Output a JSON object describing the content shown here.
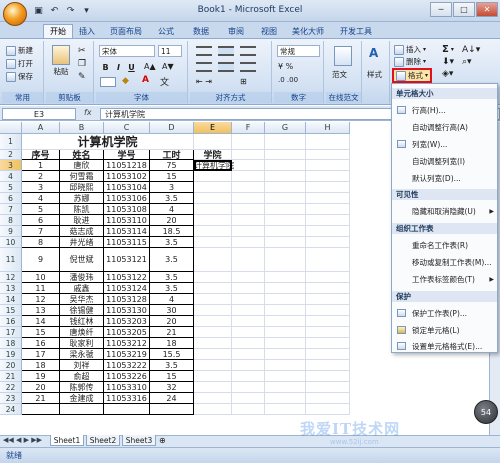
{
  "window": {
    "title": "Book1 - Microsoft Excel"
  },
  "qat": [
    "save",
    "undo",
    "redo",
    "customize"
  ],
  "tabs": [
    "开始",
    "插入",
    "页面布局",
    "公式",
    "数据",
    "审阅",
    "视图",
    "美化大师",
    "开发工具"
  ],
  "ribbon": {
    "common": {
      "new": "新建",
      "open": "打开",
      "save": "保存",
      "label": "常用"
    },
    "clipboard": {
      "paste": "粘贴",
      "label": "剪贴板"
    },
    "font": {
      "name": "宋体",
      "size": "11",
      "bold": "B",
      "italic": "I",
      "underline": "U",
      "label": "字体"
    },
    "align": {
      "label": "对齐方式"
    },
    "number": {
      "format": "常规",
      "label": "数字"
    },
    "style": {
      "label": "样式",
      "fanwen": "范文",
      "online": "在线范文"
    },
    "cells": {
      "insert": "插入",
      "delete": "删除",
      "format": "格式"
    },
    "editing": {
      "sigma": "Σ"
    }
  },
  "formula": {
    "namebox": "E3",
    "fx": "fx",
    "content": "计算机学院"
  },
  "columns": [
    "A",
    "B",
    "C",
    "D",
    "E",
    "F",
    "G",
    "H"
  ],
  "sheet": {
    "title": "计算机学院",
    "header": [
      "序号",
      "姓名",
      "学号",
      "工时",
      "学院"
    ],
    "e3": "计算机学院",
    "rows": [
      [
        "1",
        "唐欣",
        "11051218",
        "75"
      ],
      [
        "2",
        "何雪霜",
        "11053102",
        "15"
      ],
      [
        "3",
        "邱晓熙",
        "11053104",
        "3"
      ],
      [
        "4",
        "苏娜",
        "11053106",
        "3.5"
      ],
      [
        "5",
        "陈凯",
        "11053108",
        "4"
      ],
      [
        "6",
        "耿进",
        "11053110",
        "20"
      ],
      [
        "7",
        "菇志成",
        "11053114",
        "18.5"
      ],
      [
        "8",
        "井光绪",
        "11053115",
        "3.5"
      ],
      [
        "9",
        "倪世斌",
        "11053121",
        "3.5"
      ],
      [
        "10",
        "潘俊玮",
        "11053122",
        "3.5"
      ],
      [
        "11",
        "戚鑫",
        "11053124",
        "3.5"
      ],
      [
        "12",
        "吴华杰",
        "11053128",
        "4"
      ],
      [
        "13",
        "徐锡健",
        "11053130",
        "30"
      ],
      [
        "14",
        "钱红林",
        "11053203",
        "20"
      ],
      [
        "15",
        "唐焕纤",
        "11053205",
        "21"
      ],
      [
        "16",
        "耿家利",
        "11053212",
        "18"
      ],
      [
        "17",
        "梁永虢",
        "11053219",
        "15.5"
      ],
      [
        "18",
        "刘祥",
        "11053222",
        "3.5"
      ],
      [
        "19",
        "俞超",
        "11053226",
        "15"
      ],
      [
        "20",
        "陈郭传",
        "11053310",
        "32"
      ],
      [
        "21",
        "金建成",
        "11053316",
        "24"
      ]
    ]
  },
  "sheets": [
    "Sheet1",
    "Sheet2",
    "Sheet3"
  ],
  "status": {
    "ready": "就绪"
  },
  "format_menu": {
    "sec_cell_size": "单元格大小",
    "row_height": "行高(H)...",
    "autofit_row": "自动调整行高(A)",
    "col_width": "列宽(W)...",
    "autofit_col": "自动调整列宽(I)",
    "default_width": "默认列宽(D)...",
    "sec_visibility": "可见性",
    "hide_unhide": "隐藏和取消隐藏(U)",
    "sec_organize": "组织工作表",
    "rename": "重命名工作表(R)",
    "move_copy": "移动或复制工作表(M)...",
    "tab_color": "工作表标签颜色(T)",
    "sec_protect": "保护",
    "protect_sheet": "保护工作表(P)...",
    "lock_cell": "锁定单元格(L)",
    "format_cells": "设置单元格格式(E)..."
  },
  "watermark": {
    "text": "我爱IT技术网",
    "url": "www.52ij.com"
  },
  "zoom_badge": "54",
  "colors": {
    "accent_red": "#e3101d",
    "ribbon": "#d4e2f3"
  }
}
